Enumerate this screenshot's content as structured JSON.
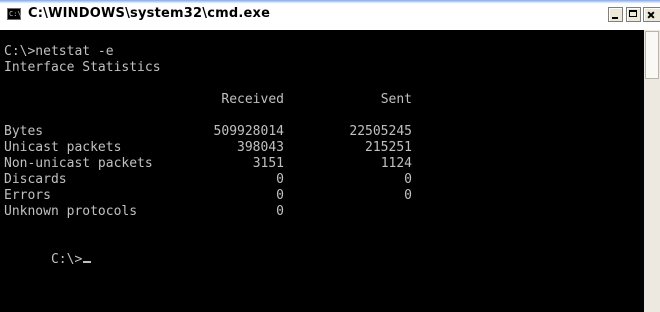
{
  "window": {
    "title": "C:\\WINDOWS\\system32\\cmd.exe",
    "icon_text": "C:\\"
  },
  "console": {
    "prompt_command": "C:\\>netstat -e",
    "header": "Interface Statistics",
    "columns": [
      "Received",
      "Sent"
    ],
    "rows": [
      {
        "label": "Bytes",
        "received": "509928014",
        "sent": "22505245"
      },
      {
        "label": "Unicast packets",
        "received": "398043",
        "sent": "215251"
      },
      {
        "label": "Non-unicast packets",
        "received": "3151",
        "sent": "1124"
      },
      {
        "label": "Discards",
        "received": "0",
        "sent": "0"
      },
      {
        "label": "Errors",
        "received": "0",
        "sent": "0"
      },
      {
        "label": "Unknown protocols",
        "received": "0",
        "sent": ""
      }
    ],
    "final_prompt": "C:\\>"
  },
  "colors": {
    "console_text": "#c0c0c0",
    "console_background": "#000000"
  }
}
